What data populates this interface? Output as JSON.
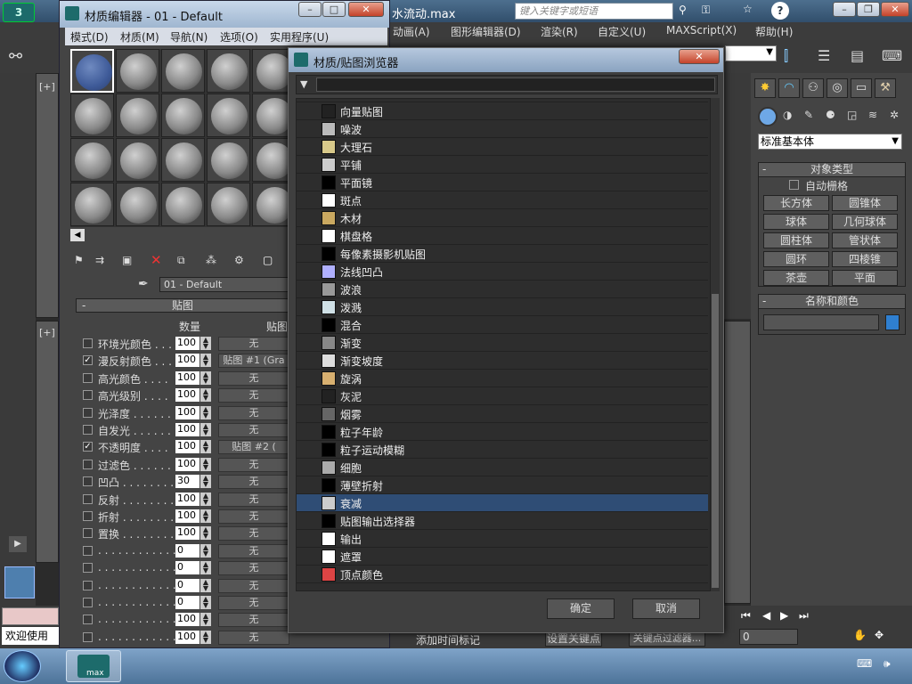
{
  "max": {
    "title_fragment": "水流动.max",
    "search_placeholder": "键入关键字或短语",
    "menu": [
      "动画(A)",
      "图形编辑器(D)",
      "渲染(R)",
      "自定义(U)",
      "MAXScript(X)",
      "帮助(H)"
    ],
    "welcome": "欢迎使用",
    "add_time_tag": "添加时间标记",
    "set_keypoint": "设置关键点",
    "keypoint_filter": "关键点过滤器...",
    "frame_value": "0",
    "viewport_label": "[+]",
    "taskbar_app": "max"
  },
  "command_panel": {
    "dropdown": "标准基本体",
    "object_type_header": "对象类型",
    "auto_grid": "自动栅格",
    "objects": [
      "长方体",
      "圆锥体",
      "球体",
      "几何球体",
      "圆柱体",
      "管状体",
      "圆环",
      "四棱锥",
      "茶壶",
      "平面"
    ],
    "name_color_header": "名称和颜色",
    "color_swatch": "#2f7fd0"
  },
  "material_editor": {
    "title": "材质编辑器 - 01 - Default",
    "menu": [
      "模式(D)",
      "材质(M)",
      "导航(N)",
      "选项(O)",
      "实用程序(U)"
    ],
    "material_name": "01 - Default",
    "maps_header": "贴图",
    "col_amount": "数量",
    "col_map": "贴图",
    "rows": [
      {
        "label": "环境光颜色 . . .",
        "checked": false,
        "amount": "100",
        "map": "无"
      },
      {
        "label": "漫反射颜色 . . .",
        "checked": true,
        "amount": "100",
        "map": "贴图 #1 (Gra"
      },
      {
        "label": "高光颜色 . . . .",
        "checked": false,
        "amount": "100",
        "map": "无"
      },
      {
        "label": "高光级别 . . . .",
        "checked": false,
        "amount": "100",
        "map": "无"
      },
      {
        "label": "光泽度 . . . . . .",
        "checked": false,
        "amount": "100",
        "map": "无"
      },
      {
        "label": "自发光 . . . . . .",
        "checked": false,
        "amount": "100",
        "map": "无"
      },
      {
        "label": "不透明度 . . . .",
        "checked": true,
        "amount": "100",
        "map": "贴图 #2 ("
      },
      {
        "label": "过滤色 . . . . . .",
        "checked": false,
        "amount": "100",
        "map": "无"
      },
      {
        "label": "凹凸 . . . . . . . .",
        "checked": false,
        "amount": "30",
        "map": "无"
      },
      {
        "label": "反射 . . . . . . . .",
        "checked": false,
        "amount": "100",
        "map": "无"
      },
      {
        "label": "折射 . . . . . . . .",
        "checked": false,
        "amount": "100",
        "map": "无"
      },
      {
        "label": "置换 . . . . . . . .",
        "checked": false,
        "amount": "100",
        "map": "无"
      },
      {
        "label": ". . . . . . . . . . . .",
        "checked": false,
        "amount": "0",
        "map": "无"
      },
      {
        "label": ". . . . . . . . . . . .",
        "checked": false,
        "amount": "0",
        "map": "无"
      },
      {
        "label": ". . . . . . . . . . . .",
        "checked": false,
        "amount": "0",
        "map": "无"
      },
      {
        "label": ". . . . . . . . . . . .",
        "checked": false,
        "amount": "0",
        "map": "无"
      },
      {
        "label": ". . . . . . . . . . . .",
        "checked": false,
        "amount": "100",
        "map": "无"
      },
      {
        "label": ". . . . . . . . . . . .",
        "checked": false,
        "amount": "100",
        "map": "无"
      }
    ]
  },
  "browser": {
    "title": "材质/贴图浏览器",
    "items": [
      {
        "label": "向量贴图",
        "color": "#222",
        "selected": false
      },
      {
        "label": "噪波",
        "color": "#bbb",
        "selected": false
      },
      {
        "label": "大理石",
        "color": "#d8c98a",
        "selected": false
      },
      {
        "label": "平铺",
        "color": "#ccc",
        "selected": false
      },
      {
        "label": "平面镜",
        "color": "#000",
        "selected": false
      },
      {
        "label": "斑点",
        "color": "#fff",
        "selected": false
      },
      {
        "label": "木材",
        "color": "#c9a860",
        "selected": false
      },
      {
        "label": "棋盘格",
        "color": "#fff",
        "selected": false
      },
      {
        "label": "每像素摄影机贴图",
        "color": "#000",
        "selected": false
      },
      {
        "label": "法线凹凸",
        "color": "#b0b0ff",
        "selected": false
      },
      {
        "label": "波浪",
        "color": "#999",
        "selected": false
      },
      {
        "label": "泼溅",
        "color": "#cfe0e6",
        "selected": false
      },
      {
        "label": "混合",
        "color": "#000",
        "selected": false
      },
      {
        "label": "渐变",
        "color": "#888",
        "selected": false
      },
      {
        "label": "渐变坡度",
        "color": "#ddd",
        "selected": false
      },
      {
        "label": "旋涡",
        "color": "#d8b070",
        "selected": false
      },
      {
        "label": "灰泥",
        "color": "#222",
        "selected": false
      },
      {
        "label": "烟雾",
        "color": "#666",
        "selected": false
      },
      {
        "label": "粒子年龄",
        "color": "#000",
        "selected": false
      },
      {
        "label": "粒子运动模糊",
        "color": "#000",
        "selected": false
      },
      {
        "label": "细胞",
        "color": "#aaa",
        "selected": false
      },
      {
        "label": "薄壁折射",
        "color": "#000",
        "selected": false
      },
      {
        "label": "衰减",
        "color": "#ccc",
        "selected": true
      },
      {
        "label": "贴图输出选择器",
        "color": "#000",
        "selected": false
      },
      {
        "label": "输出",
        "color": "#fff",
        "selected": false
      },
      {
        "label": "遮罩",
        "color": "#fff",
        "selected": false
      },
      {
        "label": "顶点颜色",
        "color": "#d44",
        "selected": false
      }
    ],
    "ok": "确定",
    "cancel": "取消"
  }
}
